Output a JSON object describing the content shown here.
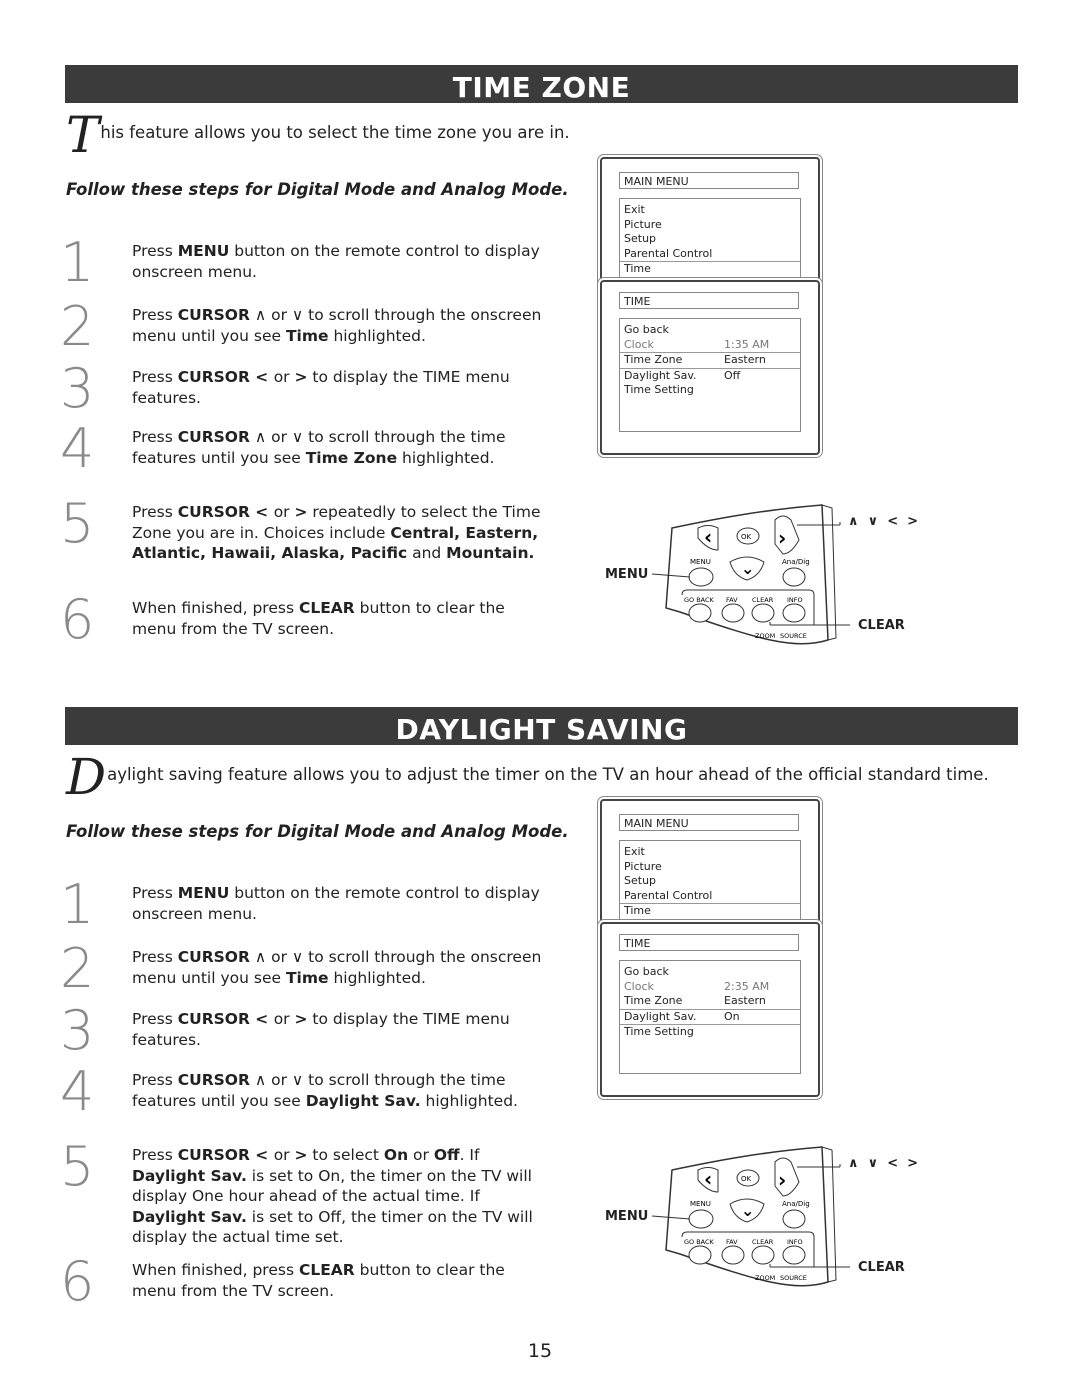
{
  "page_number": "15",
  "sections": [
    {
      "title": "TIME ZONE",
      "intro_dropcap": "T",
      "intro_rest": "his feature allows you to select the time zone you are in.",
      "follow": "Follow these steps for Digital Mode and Analog Mode.",
      "steps": [
        {
          "num": "1",
          "parts": [
            {
              "t": "Press "
            },
            {
              "t": "MENU",
              "b": true
            },
            {
              "t": " button on the remote control to display onscreen menu."
            }
          ]
        },
        {
          "num": "2",
          "parts": [
            {
              "t": "Press "
            },
            {
              "t": "CURSOR",
              "b": true
            },
            {
              "t": " ∧  or ∨ to scroll through the onscreen menu until you see "
            },
            {
              "t": "Time",
              "b": true
            },
            {
              "t": " highlighted."
            }
          ]
        },
        {
          "num": "3",
          "parts": [
            {
              "t": "Press "
            },
            {
              "t": "CURSOR",
              "b": true
            },
            {
              "t": " < ",
              "b": true
            },
            {
              "t": " or "
            },
            {
              "t": ">",
              "b": true
            },
            {
              "t": " to display the TIME menu features."
            }
          ]
        },
        {
          "num": "4",
          "parts": [
            {
              "t": "Press "
            },
            {
              "t": "CURSOR",
              "b": true
            },
            {
              "t": " ∧  or ∨ to scroll through the time features until you see "
            },
            {
              "t": "Time Zone",
              "b": true
            },
            {
              "t": " highlighted."
            }
          ]
        },
        {
          "num": "5",
          "parts": [
            {
              "t": "Press "
            },
            {
              "t": "CURSOR",
              "b": true
            },
            {
              "t": " < ",
              "b": true
            },
            {
              "t": " or "
            },
            {
              "t": ">",
              "b": true
            },
            {
              "t": " repeatedly to select the Time Zone you are in. Choices include "
            },
            {
              "t": "Central, Eastern, Atlantic, Hawaii, Alaska, Pacific",
              "b": true
            },
            {
              "t": " and "
            },
            {
              "t": "Mountain.",
              "b": true
            }
          ]
        },
        {
          "num": "6",
          "parts": [
            {
              "t": "When finished, press "
            },
            {
              "t": "CLEAR",
              "b": true
            },
            {
              "t": " button to clear the menu from the TV screen."
            }
          ]
        }
      ],
      "main_menu": {
        "title": "MAIN MENU",
        "items": [
          "Exit",
          "Picture",
          "Setup",
          "Parental Control",
          "Time"
        ],
        "selected": 4
      },
      "time_menu": {
        "title": "TIME",
        "rows": [
          {
            "label": "Go back",
            "value": ""
          },
          {
            "label": "Clock",
            "value": "1:35 AM",
            "dim": true
          },
          {
            "label": "Time Zone",
            "value": "Eastern",
            "sel": true
          },
          {
            "label": "Daylight Sav.",
            "value": "Off"
          },
          {
            "label": "Time Setting",
            "value": ""
          }
        ]
      },
      "remote": {
        "menu_label": "MENU",
        "clear_label": "CLEAR",
        "arrows_label": "∧  ∨  <  >",
        "buttons": [
          "OK",
          "MENU",
          "Ana/Dig",
          "GO BACK",
          "FAV",
          "CLEAR",
          "INFO",
          "ZOOM",
          "SOURCE"
        ]
      }
    },
    {
      "title": "DAYLIGHT SAVING",
      "intro_dropcap": "D",
      "intro_rest": "aylight saving feature allows you to adjust the timer on the TV an hour ahead of the official standard time.",
      "follow": "Follow these steps for Digital Mode and Analog Mode.",
      "steps": [
        {
          "num": "1",
          "parts": [
            {
              "t": "Press "
            },
            {
              "t": "MENU",
              "b": true
            },
            {
              "t": " button on the remote control to display onscreen menu."
            }
          ]
        },
        {
          "num": "2",
          "parts": [
            {
              "t": "Press "
            },
            {
              "t": "CURSOR",
              "b": true
            },
            {
              "t": " ∧ or ∨ to scroll through the onscreen menu until you see "
            },
            {
              "t": "Time",
              "b": true
            },
            {
              "t": " highlighted."
            }
          ]
        },
        {
          "num": "3",
          "parts": [
            {
              "t": "Press "
            },
            {
              "t": "CURSOR",
              "b": true
            },
            {
              "t": " < ",
              "b": true
            },
            {
              "t": "or "
            },
            {
              "t": ">",
              "b": true
            },
            {
              "t": " to display the TIME menu features."
            }
          ]
        },
        {
          "num": "4",
          "parts": [
            {
              "t": "Press "
            },
            {
              "t": "CURSOR",
              "b": true
            },
            {
              "t": " ∧ or ∨ to scroll through the time features until you see "
            },
            {
              "t": "Daylight Sav.",
              "b": true
            },
            {
              "t": " highlighted."
            }
          ]
        },
        {
          "num": "5",
          "parts": [
            {
              "t": "Press "
            },
            {
              "t": "CURSOR",
              "b": true
            },
            {
              "t": " < ",
              "b": true
            },
            {
              "t": "or "
            },
            {
              "t": ">",
              "b": true
            },
            {
              "t": " to select "
            },
            {
              "t": "On",
              "b": true
            },
            {
              "t": " or "
            },
            {
              "t": "Off",
              "b": true
            },
            {
              "t": ". If "
            },
            {
              "t": "Daylight Sav.",
              "b": true
            },
            {
              "t": " is set to On, the timer on the TV will display One hour ahead of the actual time. If "
            },
            {
              "t": "Daylight Sav.",
              "b": true
            },
            {
              "t": " is set to Off, the timer on the TV will display the actual time set."
            }
          ]
        },
        {
          "num": "6",
          "parts": [
            {
              "t": "When finished, press "
            },
            {
              "t": "CLEAR",
              "b": true
            },
            {
              "t": " button to clear the menu from the TV screen."
            }
          ]
        }
      ],
      "main_menu": {
        "title": "MAIN MENU",
        "items": [
          "Exit",
          "Picture",
          "Setup",
          "Parental Control",
          "Time"
        ],
        "selected": 4
      },
      "time_menu": {
        "title": "TIME",
        "rows": [
          {
            "label": "Go back",
            "value": ""
          },
          {
            "label": "Clock",
            "value": "2:35 AM",
            "dim": true
          },
          {
            "label": "Time Zone",
            "value": "Eastern"
          },
          {
            "label": "Daylight Sav.",
            "value": "On",
            "sel": true
          },
          {
            "label": "Time Setting",
            "value": ""
          }
        ]
      },
      "remote": {
        "menu_label": "MENU",
        "clear_label": "CLEAR",
        "arrows_label": "∧  ∨  <  >",
        "buttons": [
          "OK",
          "MENU",
          "Ana/Dig",
          "GO BACK",
          "FAV",
          "CLEAR",
          "INFO",
          "ZOOM",
          "SOURCE"
        ]
      }
    }
  ]
}
